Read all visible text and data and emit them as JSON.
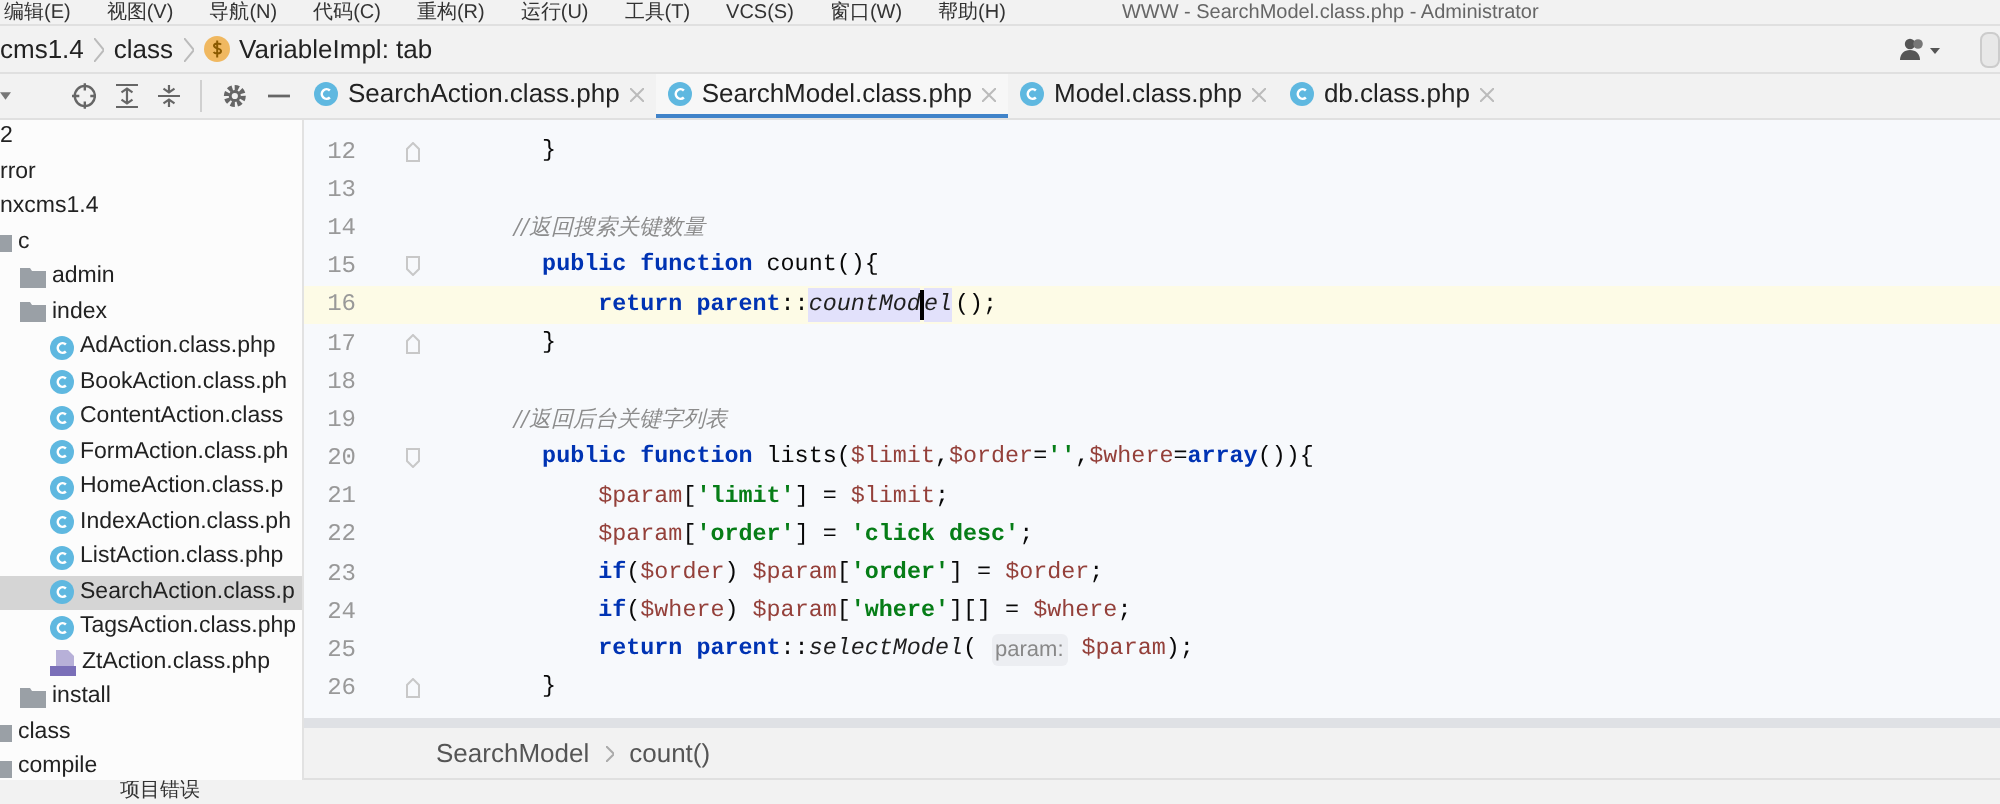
{
  "menu_bar": {
    "items": [
      "编辑(E)",
      "视图(V)",
      "导航(N)",
      "代码(C)",
      "重构(R)",
      "运行(U)",
      "工具(T)",
      "VCS(S)",
      "窗口(W)",
      "帮助(H)"
    ],
    "title": "WWW - SearchModel.class.php - Administrator"
  },
  "navigation_bar": {
    "crumbs": [
      {
        "text": "cms1.4",
        "kind": "plain"
      },
      {
        "text": "class",
        "kind": "plain"
      },
      {
        "text": "VariableImpl: tab",
        "kind": "variable"
      }
    ]
  },
  "editor_tabs": [
    {
      "label": "SearchAction.class.php",
      "selected": false
    },
    {
      "label": "SearchModel.class.php",
      "selected": true
    },
    {
      "label": "Model.class.php",
      "selected": false
    },
    {
      "label": "db.class.php",
      "selected": false
    }
  ],
  "project_tree": [
    {
      "label": "2",
      "selected": false
    },
    {
      "label": "rror",
      "selected": false
    },
    {
      "label": "nxcms1.4",
      "selected": false,
      "children": [
        {
          "label": "c",
          "kind": "folder",
          "selected": false,
          "children": [
            {
              "label": "admin",
              "kind": "folder",
              "selected": false
            },
            {
              "label": "index",
              "kind": "folder",
              "selected": false,
              "children": [
                {
                  "label": "AdAction.class.php",
                  "kind": "class",
                  "selected": false
                },
                {
                  "label": "BookAction.class.ph",
                  "kind": "class",
                  "selected": false
                },
                {
                  "label": "ContentAction.class",
                  "kind": "class",
                  "selected": false
                },
                {
                  "label": "FormAction.class.ph",
                  "kind": "class",
                  "selected": false
                },
                {
                  "label": "HomeAction.class.p",
                  "kind": "class",
                  "selected": false
                },
                {
                  "label": "IndexAction.class.ph",
                  "kind": "class",
                  "selected": false
                },
                {
                  "label": "ListAction.class.php",
                  "kind": "class",
                  "selected": false
                },
                {
                  "label": "SearchAction.class.p",
                  "kind": "class",
                  "selected": true
                },
                {
                  "label": "TagsAction.class.php",
                  "kind": "class",
                  "selected": false
                },
                {
                  "label": "ZtAction.class.php",
                  "kind": "php",
                  "selected": false
                }
              ]
            },
            {
              "label": "install",
              "kind": "folder",
              "selected": false
            }
          ]
        },
        {
          "label": "class",
          "kind": "folder",
          "selected": false
        },
        {
          "label": "compile",
          "kind": "folder",
          "selected": false
        }
      ]
    }
  ],
  "code_lines": [
    {
      "number": "12",
      "fold_start": false,
      "fold_end": true,
      "current": false,
      "tokens": [
        {
          "kind": "plain",
          "text": "    }"
        }
      ]
    },
    {
      "number": "13",
      "fold_start": false,
      "fold_end": false,
      "current": false
    },
    {
      "number": "14",
      "fold_start": false,
      "fold_end": false,
      "current": false,
      "tokens": [
        {
          "kind": "comment",
          "text": "    //返回搜索关键数量"
        }
      ]
    },
    {
      "number": "15",
      "fold_start": true,
      "fold_end": false,
      "current": false,
      "tokens": [
        {
          "kind": "keyword",
          "text": "    public function "
        },
        {
          "kind": "plain",
          "text": "count(){"
        }
      ]
    },
    {
      "number": "16",
      "fold_start": false,
      "fold_end": false,
      "current": true,
      "tokens": [
        {
          "kind": "keyword",
          "text": "        return parent"
        },
        {
          "kind": "plain",
          "text": "::"
        },
        {
          "kind": "call",
          "text": "countMod",
          "highlight": true,
          "caret_after": true
        },
        {
          "kind": "call",
          "text": "el",
          "highlight": true,
          "caret_after": false
        },
        {
          "kind": "plain",
          "text": "();"
        }
      ]
    },
    {
      "number": "17",
      "fold_start": false,
      "fold_end": true,
      "current": false,
      "tokens": [
        {
          "kind": "plain",
          "text": "    }"
        }
      ]
    },
    {
      "number": "18",
      "fold_start": false,
      "fold_end": false,
      "current": false
    },
    {
      "number": "19",
      "fold_start": false,
      "fold_end": false,
      "current": false,
      "tokens": [
        {
          "kind": "comment",
          "text": "    //返回后台关键字列表"
        }
      ]
    },
    {
      "number": "20",
      "fold_start": true,
      "fold_end": false,
      "current": false,
      "tokens": [
        {
          "kind": "keyword",
          "text": "    public function "
        },
        {
          "kind": "plain",
          "text": "lists("
        },
        {
          "kind": "var",
          "text": "$limit"
        },
        {
          "kind": "plain",
          "text": ","
        },
        {
          "kind": "var",
          "text": "$order"
        },
        {
          "kind": "plain",
          "text": "="
        },
        {
          "kind": "string",
          "text": "''"
        },
        {
          "kind": "plain",
          "text": ","
        },
        {
          "kind": "var",
          "text": "$where"
        },
        {
          "kind": "plain",
          "text": "="
        },
        {
          "kind": "keyword",
          "text": "array"
        },
        {
          "kind": "plain",
          "text": "()){"
        }
      ]
    },
    {
      "number": "21",
      "fold_start": false,
      "fold_end": false,
      "current": false,
      "tokens": [
        {
          "kind": "var",
          "text": "        $param"
        },
        {
          "kind": "plain",
          "text": "["
        },
        {
          "kind": "string",
          "text": "'limit'"
        },
        {
          "kind": "plain",
          "text": "] = "
        },
        {
          "kind": "var",
          "text": "$limit"
        },
        {
          "kind": "plain",
          "text": ";"
        }
      ]
    },
    {
      "number": "22",
      "fold_start": false,
      "fold_end": false,
      "current": false,
      "tokens": [
        {
          "kind": "var",
          "text": "        $param"
        },
        {
          "kind": "plain",
          "text": "["
        },
        {
          "kind": "string",
          "text": "'order'"
        },
        {
          "kind": "plain",
          "text": "] = "
        },
        {
          "kind": "string",
          "text": "'click desc'"
        },
        {
          "kind": "plain",
          "text": ";"
        }
      ]
    },
    {
      "number": "23",
      "fold_start": false,
      "fold_end": false,
      "current": false,
      "tokens": [
        {
          "kind": "keyword",
          "text": "        if"
        },
        {
          "kind": "plain",
          "text": "("
        },
        {
          "kind": "var",
          "text": "$order"
        },
        {
          "kind": "plain",
          "text": ") "
        },
        {
          "kind": "var",
          "text": "$param"
        },
        {
          "kind": "plain",
          "text": "["
        },
        {
          "kind": "string",
          "text": "'order'"
        },
        {
          "kind": "plain",
          "text": "] = "
        },
        {
          "kind": "var",
          "text": "$order"
        },
        {
          "kind": "plain",
          "text": ";"
        }
      ]
    },
    {
      "number": "24",
      "fold_start": false,
      "fold_end": false,
      "current": false,
      "tokens": [
        {
          "kind": "keyword",
          "text": "        if"
        },
        {
          "kind": "plain",
          "text": "("
        },
        {
          "kind": "var",
          "text": "$where"
        },
        {
          "kind": "plain",
          "text": ") "
        },
        {
          "kind": "var",
          "text": "$param"
        },
        {
          "kind": "plain",
          "text": "["
        },
        {
          "kind": "string",
          "text": "'where'"
        },
        {
          "kind": "plain",
          "text": "][] = "
        },
        {
          "kind": "var",
          "text": "$where"
        },
        {
          "kind": "plain",
          "text": ";"
        }
      ]
    },
    {
      "number": "25",
      "fold_start": false,
      "fold_end": false,
      "current": false,
      "tokens": [
        {
          "kind": "keyword",
          "text": "        return parent"
        },
        {
          "kind": "plain",
          "text": "::"
        },
        {
          "kind": "call",
          "text": "selectModel"
        },
        {
          "kind": "plain",
          "text": "( "
        },
        {
          "kind": "hint",
          "text": "param:"
        },
        {
          "kind": "var",
          "text": " $param"
        },
        {
          "kind": "plain",
          "text": ");"
        }
      ]
    },
    {
      "number": "26",
      "fold_start": false,
      "fold_end": true,
      "current": false,
      "tokens": [
        {
          "kind": "plain",
          "text": "    }"
        }
      ]
    }
  ],
  "editor_breadcrumb": [
    "SearchModel",
    "count()"
  ],
  "tool_window_bar": {
    "items": [
      "项目错误"
    ]
  }
}
